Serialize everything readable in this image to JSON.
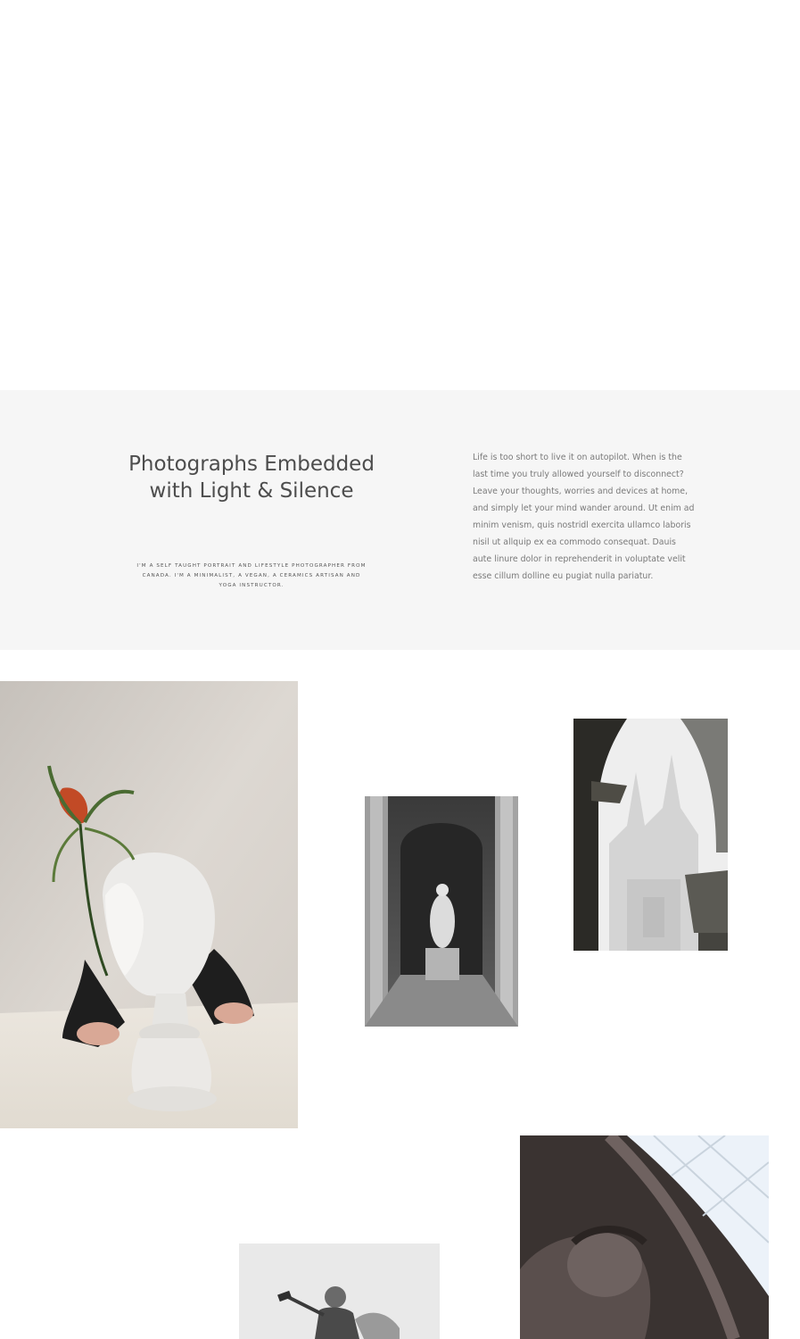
{
  "intro": {
    "title": "Photographs Embedded with Light & Silence",
    "caption": "I'M A SELF TAUGHT PORTRAIT AND LIFESTYLE PHOTOGRAPHER FROM CANADA. I'M A MINIMALIST, A VEGAN, A CERAMICS ARTISAN AND YOGA INSTRUCTOR.",
    "body": "Life is too short to live it on autopilot. When is the last time you truly allowed yourself to disconnect? Leave your thoughts, worries and devices at home, and simply let your mind wander around. Ut enim ad minim venism, quis nostridl exercita ullamco laboris nisil ut allquip ex ea commodo consequat. Dauis aute linure dolor in reprehenderit in voluptate velit esse cillum dolline eu pugiat nulla pariatur."
  },
  "colors": {
    "intro_background": "#f6f6f6",
    "heading_text": "#4d4d4d",
    "body_text": "#7a7a7a"
  },
  "gallery": [
    {
      "name": "bust-with-flower-photo"
    },
    {
      "name": "statue-in-archway-photo"
    },
    {
      "name": "cathedral-through-arch-photo"
    },
    {
      "name": "angel-statue-photo"
    },
    {
      "name": "dome-and-sculpture-photo"
    }
  ]
}
